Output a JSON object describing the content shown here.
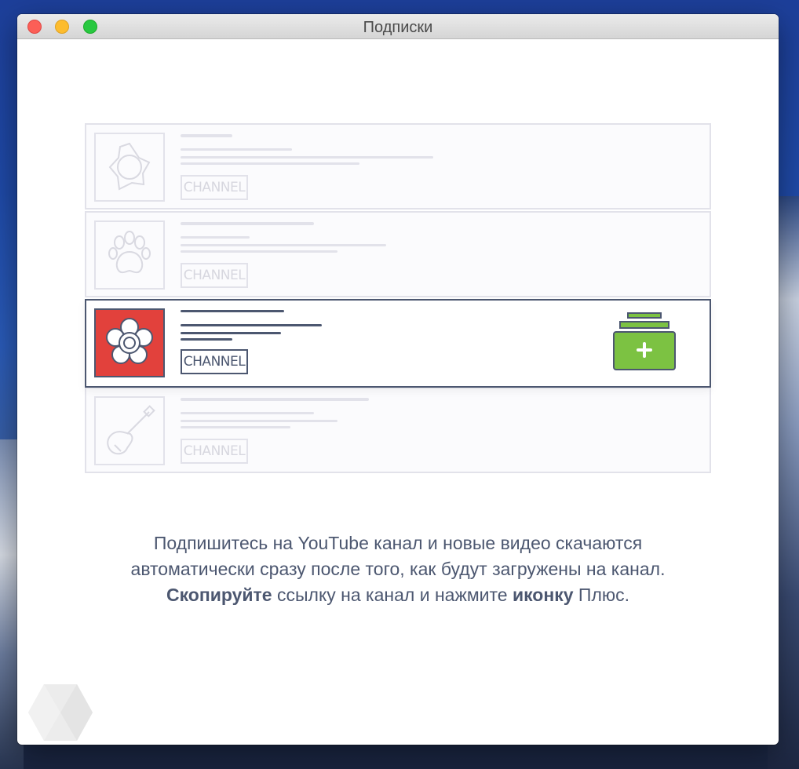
{
  "window": {
    "title": "Подписки"
  },
  "illustration": {
    "rows": [
      {
        "icon": "sun-icon",
        "badge": "CHANNEL",
        "active": false
      },
      {
        "icon": "paw-icon",
        "badge": "CHANNEL",
        "active": false
      },
      {
        "icon": "flower-icon",
        "badge": "CHANNEL",
        "active": true
      },
      {
        "icon": "guitar-icon",
        "badge": "CHANNEL",
        "active": false
      }
    ],
    "add_button_icon": "add-subscription-icon",
    "active_color": "#e2413c",
    "add_button_color": "#7cc242"
  },
  "description": {
    "line1": "Подпишитесь на YouTube канал и новые видео скачаются",
    "line2": "автоматически сразу после того, как будут загружены на канал.",
    "line3_bold1": "Скопируйте",
    "line3_mid": " ссылку на канал и нажмите ",
    "line3_bold2": "иконку",
    "line3_end": " Плюс."
  },
  "footer": {
    "logo_icon": "cube-logo-icon"
  }
}
